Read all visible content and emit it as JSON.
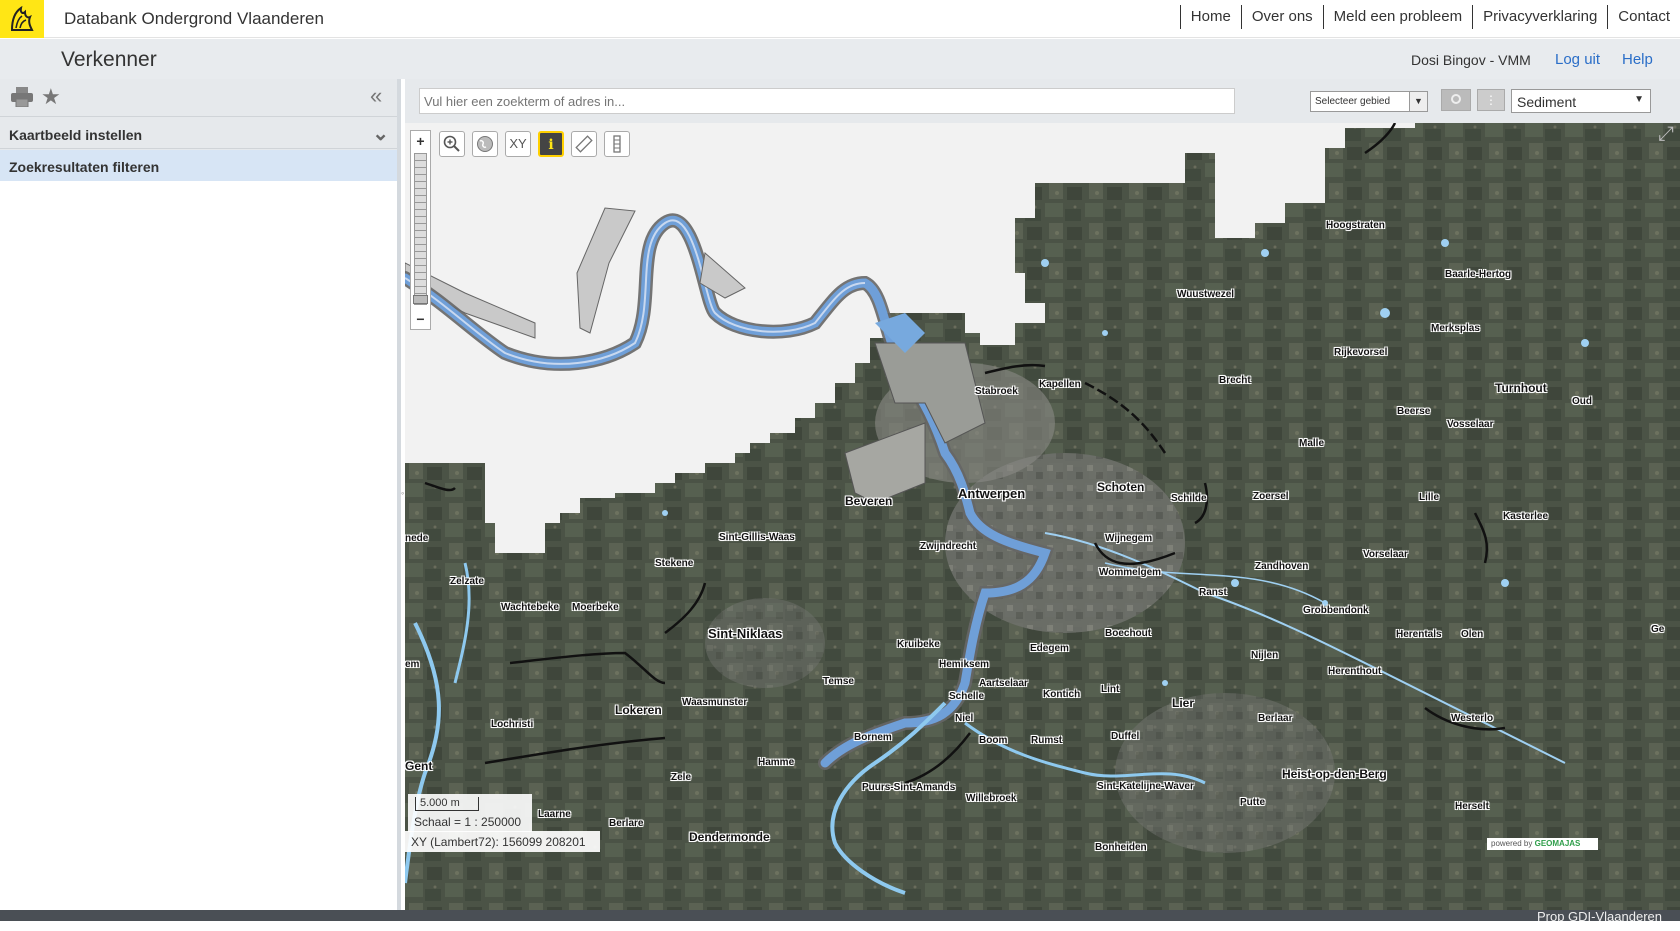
{
  "header": {
    "site_title": "Databank Ondergrond Vlaanderen",
    "nav": [
      "Home",
      "Over ons",
      "Meld een probleem",
      "Privacyverklaring",
      "Contact"
    ]
  },
  "subheader": {
    "app_title": "Verkenner",
    "user": "Dosi Bingov - VMM",
    "logout": "Log uit",
    "help": "Help"
  },
  "sidebar": {
    "panels": [
      "Kaartbeeld instellen",
      "Zoekresultaten filteren"
    ]
  },
  "search": {
    "placeholder": "Vul hier een zoekterm of adres in...",
    "area_select": "Selecteer gebied",
    "layer_select": "Sediment"
  },
  "map": {
    "tools": {
      "zoom_in": "+",
      "zoom_out": "−",
      "xy": "XY",
      "info": "i"
    },
    "scale_bar": "5.000 m",
    "scale_text": "Schaal = 1 : 250000",
    "coords": "XY (Lambert72): 156099 208201",
    "attribution_prefix": "powered by",
    "attribution_brand": "GEOMAJAS",
    "places": [
      {
        "name": "Hoogstraten"
      },
      {
        "name": "Baarle-Hertog"
      },
      {
        "name": "Wuustwezel"
      },
      {
        "name": "Merksplas"
      },
      {
        "name": "Rijkevorsel"
      },
      {
        "name": "Stabroek"
      },
      {
        "name": "Kapellen"
      },
      {
        "name": "Brecht"
      },
      {
        "name": "Turnhout"
      },
      {
        "name": "Oud"
      },
      {
        "name": "Beerse"
      },
      {
        "name": "Vosselaar"
      },
      {
        "name": "Malle"
      },
      {
        "name": "Beveren"
      },
      {
        "name": "Antwerpen"
      },
      {
        "name": "Schoten"
      },
      {
        "name": "Schilde"
      },
      {
        "name": "Zoersel"
      },
      {
        "name": "Lille"
      },
      {
        "name": "Kasterlee"
      },
      {
        "name": "nede"
      },
      {
        "name": "Sint-Gillis-Waas"
      },
      {
        "name": "Zwijndrecht"
      },
      {
        "name": "Wijnegem"
      },
      {
        "name": "Stekene"
      },
      {
        "name": "Wommelgem"
      },
      {
        "name": "Zandhoven"
      },
      {
        "name": "Vorselaar"
      },
      {
        "name": "Zelzate"
      },
      {
        "name": "Ranst"
      },
      {
        "name": "Wachtebeke"
      },
      {
        "name": "Moerbeke"
      },
      {
        "name": "Grobbendonk"
      },
      {
        "name": "Sint-Niklaas"
      },
      {
        "name": "Boechout"
      },
      {
        "name": "Herentals"
      },
      {
        "name": "Olen"
      },
      {
        "name": "Ge"
      },
      {
        "name": "Kruibeke"
      },
      {
        "name": "Edegem"
      },
      {
        "name": "Nijlen"
      },
      {
        "name": "Hemiksem"
      },
      {
        "name": "em"
      },
      {
        "name": "Herenthout"
      },
      {
        "name": "Temse"
      },
      {
        "name": "Aartselaar"
      },
      {
        "name": "Lint"
      },
      {
        "name": "Schelle"
      },
      {
        "name": "Kontich"
      },
      {
        "name": "Lier"
      },
      {
        "name": "Waasmunster"
      },
      {
        "name": "Lokeren"
      },
      {
        "name": "Niel"
      },
      {
        "name": "Berlaar"
      },
      {
        "name": "Westerlo"
      },
      {
        "name": "Lochristi"
      },
      {
        "name": "Bornem"
      },
      {
        "name": "Duffel"
      },
      {
        "name": "Boom"
      },
      {
        "name": "Rumst"
      },
      {
        "name": "Gent"
      },
      {
        "name": "Hamme"
      },
      {
        "name": "Heist-op-den-Berg"
      },
      {
        "name": "Zele"
      },
      {
        "name": "Puurs-Sint-Amands"
      },
      {
        "name": "Sint-Katelijne-Waver"
      },
      {
        "name": "Willebroek"
      },
      {
        "name": "Putte"
      },
      {
        "name": "Herselt"
      },
      {
        "name": "Laarne"
      },
      {
        "name": "Berlare"
      },
      {
        "name": "Dendermonde"
      },
      {
        "name": "Bonheiden"
      }
    ]
  },
  "footer": {
    "text": "Prop GDI-Vlaanderen"
  },
  "colors": {
    "brand_yellow": "#ffe615",
    "link_blue": "#2a6ec8",
    "river_blue": "#6f9fd8",
    "footer_bg": "#4a4f55"
  }
}
